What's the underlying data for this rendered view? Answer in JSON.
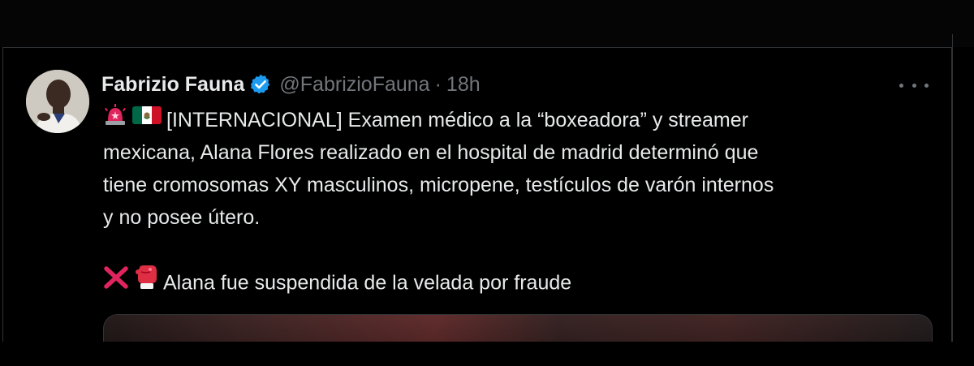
{
  "tweet": {
    "author_name": "Fabrizio Fauna",
    "handle": "@FabrizioFauna",
    "separator": "·",
    "time": "18h",
    "lines": [
      "[INTERNACIONAL] Examen médico a la “boxeadora” y streamer",
      "mexicana, Alana Flores realizado en el hospital de madrid determinó que",
      "tiene cromosomas XY masculinos, micropene, testículos de varón internos",
      "y no posee útero."
    ],
    "second_paragraph": "Alana fue suspendida de la velada por fraude",
    "icons": {
      "verified": "verified-badge-icon",
      "more": "more-options-icon",
      "line1_emojis": [
        "siren-emoji",
        "mexico-flag-emoji"
      ],
      "line2_emojis": [
        "cross-mark-emoji",
        "boxing-glove-emoji"
      ]
    },
    "colors": {
      "background": "#000000",
      "text": "#e7e9ea",
      "muted": "#71767b",
      "verified": "#1d9bf0",
      "border": "#2f3336"
    }
  }
}
